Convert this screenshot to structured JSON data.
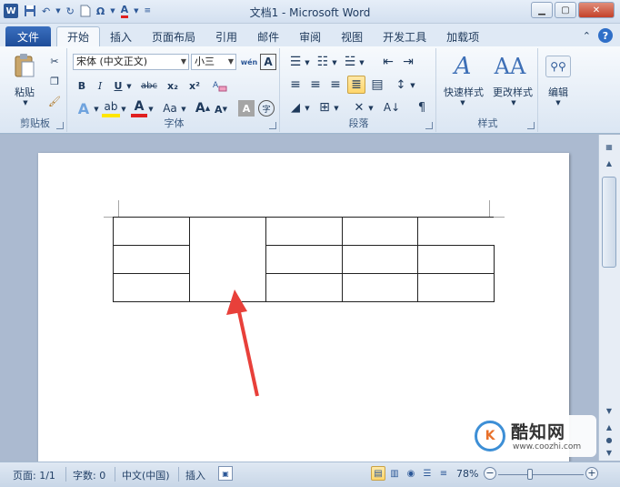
{
  "title_bar": {
    "title": "文档1 - Microsoft Word",
    "app_icon": "W",
    "qat_icons": [
      "save-icon",
      "undo-icon",
      "redo-icon",
      "new-document-icon",
      "symbol-omega-icon",
      "font-color-icon",
      "customize-qat-icon"
    ],
    "window_buttons": [
      "minimize",
      "maximize",
      "close"
    ]
  },
  "tabs": {
    "file": "文件",
    "items": [
      "开始",
      "插入",
      "页面布局",
      "引用",
      "邮件",
      "审阅",
      "视图",
      "开发工具",
      "加载项"
    ],
    "active": "开始"
  },
  "ribbon": {
    "clipboard": {
      "label": "剪贴板",
      "paste": "粘贴"
    },
    "font": {
      "label": "字体",
      "font_name": "宋体 (中文正文)",
      "font_size": "小三",
      "wen_button": "wén",
      "bold": "B",
      "italic": "I",
      "underline": "U",
      "strike": "abc",
      "subscript": "x₂",
      "superscript": "x²",
      "change_case": "Aa",
      "grow": "A",
      "shrink": "A",
      "char_border": "A",
      "enclose": "字"
    },
    "paragraph": {
      "label": "段落"
    },
    "styles": {
      "label": "样式",
      "quick_styles": "快速样式",
      "change_styles": "更改样式"
    },
    "editing": {
      "label": "编辑"
    }
  },
  "annotation": {
    "arrow_color": "#e8403a"
  },
  "watermark": {
    "logo_letter": "K",
    "title": "酷知网",
    "url": "www.coozhi.com"
  },
  "status_bar": {
    "page": "页面: 1/1",
    "words": "字数: 0",
    "language": "中文(中国)",
    "mode": "插入",
    "zoom": "78%",
    "zoom_minus": "−",
    "zoom_plus": "+"
  },
  "colors": {
    "file_tab": "#2b5797",
    "ribbon_bg": "#dbe6f3",
    "document_bg": "#abbad0",
    "table_border": "#222222"
  }
}
